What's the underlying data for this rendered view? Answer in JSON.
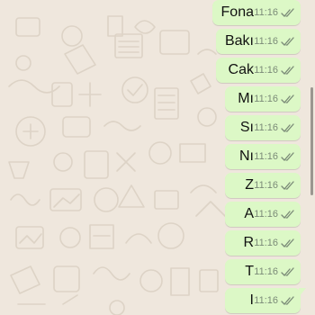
{
  "chat": {
    "messages": [
      {
        "text": "Fona",
        "time": "11:16",
        "status": "read"
      },
      {
        "text": "Bakı",
        "time": "11:16",
        "status": "read"
      },
      {
        "text": "Cak",
        "time": "11:16",
        "status": "read"
      },
      {
        "text": "Mı",
        "time": "11:16",
        "status": "read"
      },
      {
        "text": "Sı",
        "time": "11:16",
        "status": "read"
      },
      {
        "text": "Nı",
        "time": "11:16",
        "status": "read"
      },
      {
        "text": "Z",
        "time": "11:16",
        "status": "read"
      },
      {
        "text": "A",
        "time": "11:16",
        "status": "read"
      },
      {
        "text": "R",
        "time": "11:16",
        "status": "read"
      },
      {
        "text": "T",
        "time": "11:16",
        "status": "read"
      },
      {
        "text": "I",
        "time": "11:16",
        "status": "read"
      }
    ]
  },
  "colors": {
    "background": "#efe7dd",
    "outgoing_bubble": "#dcf8c6",
    "read_tick": "#7a8a77"
  },
  "icons": {
    "status": "double-check-icon"
  }
}
